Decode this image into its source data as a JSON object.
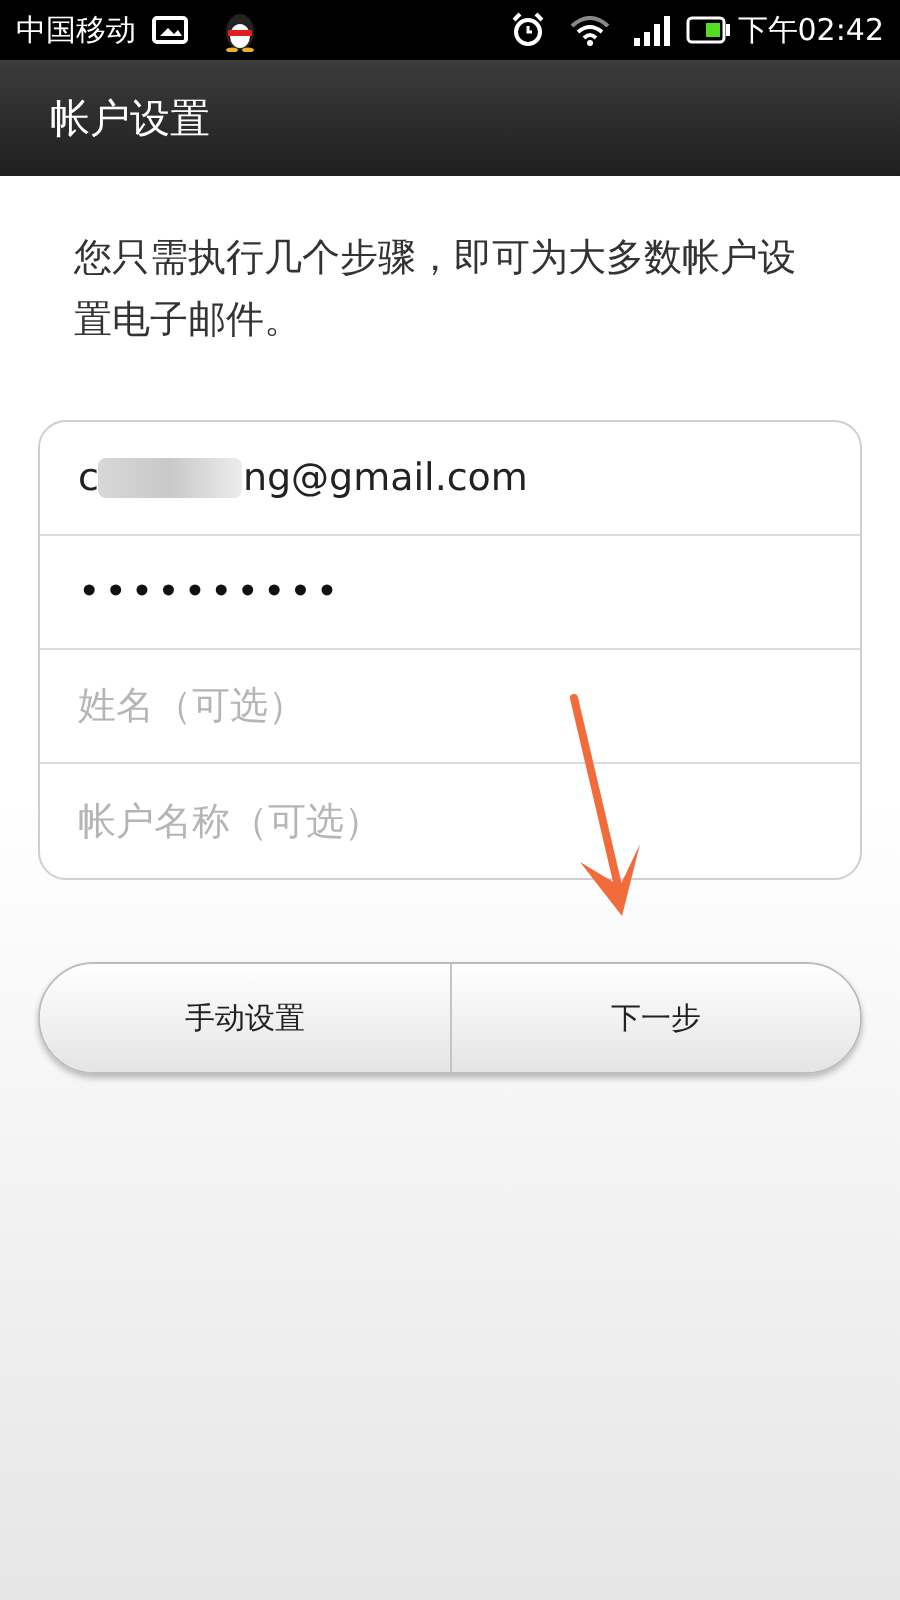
{
  "status_bar": {
    "carrier": "中国移动",
    "time": "下午02:42"
  },
  "title_bar": {
    "title": "帐户设置"
  },
  "intro": "您只需执行几个步骤，即可为大多数帐户设置电子邮件。",
  "fields": [
    {
      "kind": "email",
      "value_start": "c",
      "value_end": "ng@gmail.com"
    },
    {
      "kind": "password",
      "value": "••••••••••"
    },
    {
      "kind": "text",
      "placeholder": "姓名（可选）"
    },
    {
      "kind": "text",
      "placeholder": "帐户名称（可选）"
    }
  ],
  "buttons": [
    {
      "label": "手动设置"
    },
    {
      "label": "下一步"
    }
  ]
}
